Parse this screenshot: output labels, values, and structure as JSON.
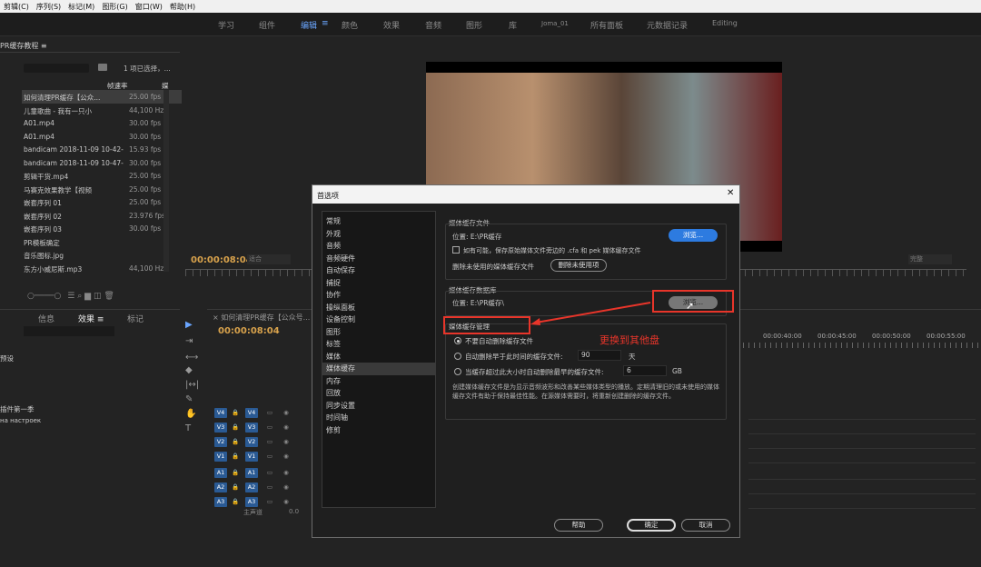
{
  "menubar": [
    "剪辑(C)",
    "序列(S)",
    "标记(M)",
    "图形(G)",
    "窗口(W)",
    "帮助(H)"
  ],
  "workspaces": [
    "学习",
    "组件",
    "编辑",
    "颜色",
    "效果",
    "音频",
    "图形",
    "库",
    "Joma_01",
    "所有面板",
    "元数据记录",
    "Editing"
  ],
  "project": {
    "title": "PR缓存教程 ≡",
    "selected_info": "1 项已选择，...",
    "col_rate": "帧速率",
    "items": [
      {
        "name": "如何清理PR缓存【公众...",
        "rate": "25.00 fps"
      },
      {
        "name": "儿童歌曲 - 我有一只小",
        "rate": "44,100 Hz"
      },
      {
        "name": "A01.mp4",
        "rate": "30.00 fps"
      },
      {
        "name": "A01.mp4",
        "rate": "30.00 fps"
      },
      {
        "name": "bandicam 2018-11-09 10-42-",
        "rate": "15.93 fps"
      },
      {
        "name": "bandicam 2018-11-09 10-47-",
        "rate": "30.00 fps"
      },
      {
        "name": "剪辑干货.mp4",
        "rate": "25.00 fps"
      },
      {
        "name": "马赛克效果教学【视频",
        "rate": "25.00 fps"
      },
      {
        "name": "嵌套序列 01",
        "rate": "25.00 fps"
      },
      {
        "name": "嵌套序列 02",
        "rate": "23.976 fps"
      },
      {
        "name": "嵌套序列 03",
        "rate": "30.00 fps"
      },
      {
        "name": "PR模板确定",
        "rate": ""
      },
      {
        "name": "音乐图标.jpg",
        "rate": ""
      },
      {
        "name": "东方小威尼斯.mp3",
        "rate": "44,100 Hz"
      }
    ]
  },
  "effects": {
    "tabs": [
      "信息",
      "效果 ≡",
      "标记"
    ],
    "items": [
      "预设",
      "",
      "",
      "",
      "",
      "插件第一季",
      "на настроек"
    ]
  },
  "program": {
    "timecode": "00:00:08:04",
    "fit": "适合",
    "quality": "完整"
  },
  "timeline": {
    "title": "如何清理PR缓存【公众号...",
    "timecode": "00:00:08:04",
    "ruler": [
      "00:00:40:00",
      "00:00:45:00",
      "00:00:50:00",
      "00:00:55:00"
    ],
    "video_tracks": [
      "V4",
      "V3",
      "V2",
      "V1"
    ],
    "audio_tracks": [
      "A1",
      "A2",
      "A3"
    ],
    "master": "主声道",
    "master_val": "0.0"
  },
  "dialog": {
    "title": "首选项",
    "categories": [
      "常规",
      "外观",
      "音频",
      "音频硬件",
      "自动保存",
      "捕捉",
      "协作",
      "操纵面板",
      "设备控制",
      "图形",
      "标签",
      "媒体",
      "媒体缓存",
      "内存",
      "回放",
      "同步设置",
      "时间轴",
      "修剪"
    ],
    "selected_category": "媒体缓存",
    "cache_files": {
      "title": "媒体缓存文件",
      "location": "位置:  E:\\PR缓存",
      "browse": "浏览...",
      "checkbox": "如有可能，保存原始媒体文件旁边的 .cfa 和 pek 媒体缓存文件",
      "delete_label": "删除未使用的媒体缓存文件",
      "delete_btn": "删除未使用项"
    },
    "cache_db": {
      "title": "媒体缓存数据库",
      "location": "位置:  E:\\PR缓存\\",
      "browse": "浏览..."
    },
    "cache_mgmt": {
      "title": "媒体缓存管理",
      "opt1": "不要自动删除缓存文件",
      "opt2": "自动删除早于此时间的缓存文件:",
      "opt2_val": "90",
      "opt2_unit": "天",
      "opt3": "当缓存超过此大小时自动删除最早的缓存文件:",
      "opt3_val": "6",
      "opt3_unit": "GB",
      "desc": "创建媒体缓存文件是为显示音频波形和改善某些媒体类型的播放。定期清理旧的或未使用的媒体缓存文件有助于保持最佳性能。在源媒体需要时，将重新创建删除的缓存文件。"
    },
    "annotation": "更换到其他盘",
    "help": "帮助",
    "ok": "确定",
    "cancel": "取消"
  },
  "colors": {
    "accent": "#2d7be0",
    "annotation": "#e8352a",
    "timecode": "#d8a24c"
  }
}
